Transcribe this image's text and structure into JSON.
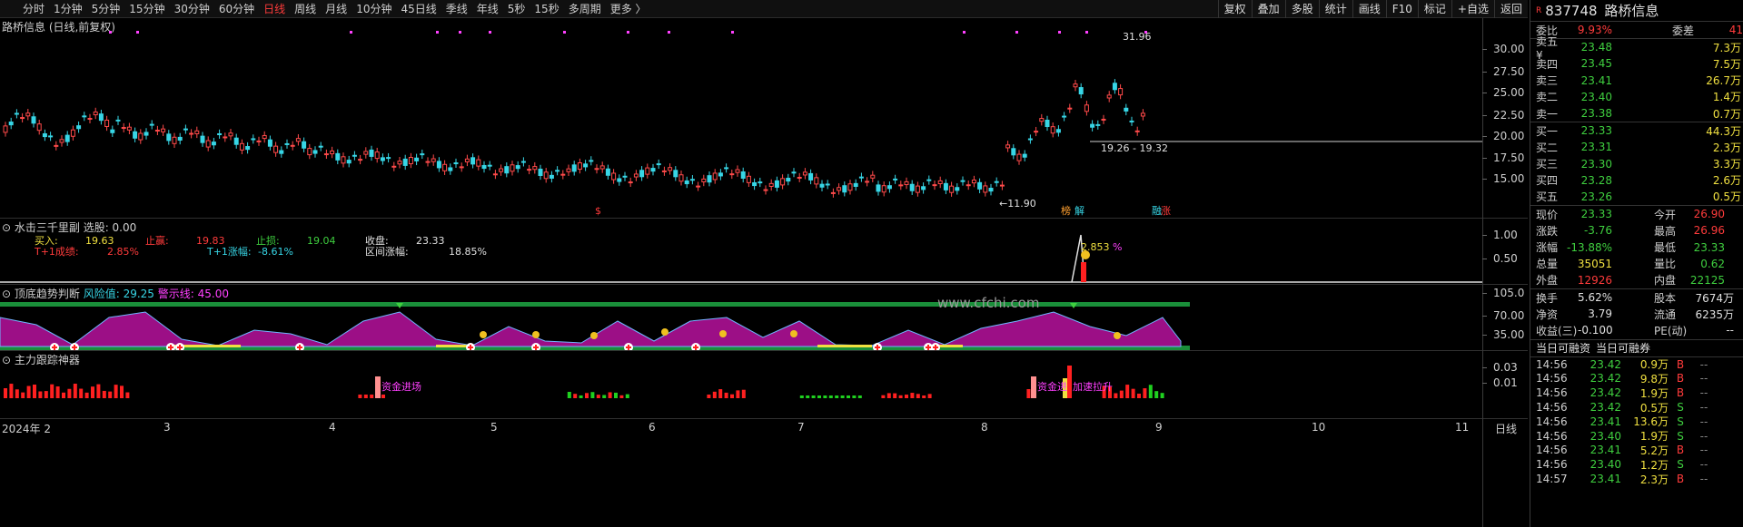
{
  "toolbar": {
    "periods": [
      "分时",
      "1分钟",
      "5分钟",
      "15分钟",
      "30分钟",
      "60分钟",
      "日线",
      "周线",
      "月线",
      "10分钟",
      "45日线",
      "季线",
      "年线",
      "5秒",
      "15秒",
      "多周期",
      "更多 〉"
    ],
    "active_period": "日线",
    "tools": [
      "复权",
      "叠加",
      "多股",
      "统计",
      "画线",
      "F10",
      "标记",
      "+自选",
      "返回"
    ]
  },
  "main_panel": {
    "title": "路桥信息 (日线,前复权)",
    "annotations": {
      "high": "31.96",
      "low": "←11.90",
      "range": "19.26 - 19.32"
    },
    "signals": [
      "$",
      "榜",
      "解",
      "融",
      "涨"
    ],
    "price_axis": [
      "30.00",
      "27.50",
      "25.00",
      "22.50",
      "20.00",
      "17.50",
      "15.00"
    ]
  },
  "panel2": {
    "title": "水击三千里副  选股: 0.00",
    "labels": [
      {
        "k": "买入:",
        "v": "19.63",
        "kc": "#f0e040",
        "vc": "#f0e040"
      },
      {
        "k": "止赢:",
        "v": "19.83",
        "kc": "#ff3b3b",
        "vc": "#ff3b3b"
      },
      {
        "k": "止损:",
        "v": "19.04",
        "kc": "#3fcf3f",
        "vc": "#3fcf3f"
      },
      {
        "k": "收盘:",
        "v": "23.33",
        "kc": "#e0e0e0",
        "vc": "#e0e0e0"
      },
      {
        "k": "T+1成绩:",
        "v": "2.85%",
        "kc": "#ff3b3b",
        "vc": "#ff3b3b"
      },
      {
        "k": "T+1涨幅:",
        "v": "-8.61%",
        "kc": "#37d6e6",
        "vc": "#37d6e6"
      },
      {
        "k": "区间涨幅:",
        "v": "18.85%",
        "kc": "#e0e0e0",
        "vc": "#e0e0e0"
      }
    ],
    "peak_label": "2.853",
    "peak_unit": "%",
    "axis": [
      "1.00",
      "0.50"
    ]
  },
  "panel3": {
    "title": "顶底趋势判断",
    "risk_label": "风险值: 29.25",
    "warn_label": "警示线: 45.00",
    "axis": [
      "105.0",
      "70.00",
      "35.00"
    ],
    "watermark": "www.cfchi.com"
  },
  "panel4": {
    "title": "主力跟踪神器",
    "axis": [
      "0.03",
      "0.01"
    ],
    "tags": [
      "资金进场",
      "资金进",
      "加速拉升"
    ]
  },
  "date_axis": [
    "2024年 2",
    "3",
    "4",
    "5",
    "6",
    "7",
    "8",
    "9",
    "10",
    "11"
  ],
  "date_axis_mode": "日线",
  "quote": {
    "code": "837748",
    "name": "路桥信息",
    "ratio": {
      "k1": "委比",
      "v1": "9.93%",
      "k2": "委差",
      "v2": "41"
    },
    "asks": [
      {
        "label": "卖五 ¥",
        "price": "23.48",
        "vol": "7.3万"
      },
      {
        "label": "卖四",
        "price": "23.45",
        "vol": "7.5万"
      },
      {
        "label": "卖三",
        "price": "23.41",
        "vol": "26.7万"
      },
      {
        "label": "卖二",
        "price": "23.40",
        "vol": "1.4万"
      },
      {
        "label": "卖一",
        "price": "23.38",
        "vol": "0.7万"
      }
    ],
    "bids": [
      {
        "label": "买一",
        "price": "23.33",
        "vol": "44.3万"
      },
      {
        "label": "买二",
        "price": "23.31",
        "vol": "2.3万"
      },
      {
        "label": "买三",
        "price": "23.30",
        "vol": "3.3万"
      },
      {
        "label": "买四",
        "price": "23.28",
        "vol": "2.6万"
      },
      {
        "label": "买五",
        "price": "23.26",
        "vol": "0.5万"
      }
    ],
    "stats": [
      {
        "k1": "现价",
        "v1": "23.33",
        "c1": "green",
        "k2": "今开",
        "v2": "26.90",
        "c2": "red"
      },
      {
        "k1": "涨跌",
        "v1": "-3.76",
        "c1": "green",
        "k2": "最高",
        "v2": "26.96",
        "c2": "red"
      },
      {
        "k1": "涨幅",
        "v1": "-13.88%",
        "c1": "green",
        "k2": "最低",
        "v2": "23.33",
        "c2": "green"
      },
      {
        "k1": "总量",
        "v1": "35051",
        "c1": "yel",
        "k2": "量比",
        "v2": "0.62",
        "c2": "green"
      },
      {
        "k1": "外盘",
        "v1": "12926",
        "c1": "red",
        "k2": "内盘",
        "v2": "22125",
        "c2": "green"
      }
    ],
    "stats2": [
      {
        "k1": "换手",
        "v1": "5.62%",
        "k2": "股本",
        "v2": "7674万"
      },
      {
        "k1": "净资",
        "v1": "3.79",
        "k2": "流通",
        "v2": "6235万"
      },
      {
        "k1": "收益(三)",
        "v1": "-0.100",
        "k2": "PE(动)",
        "v2": "--"
      }
    ],
    "margin": {
      "a": "当日可融资",
      "b": "当日可融券"
    },
    "ticks": [
      {
        "t": "14:56",
        "p": "23.42",
        "v": "0.9万",
        "s": "B"
      },
      {
        "t": "14:56",
        "p": "23.42",
        "v": "9.8万",
        "s": "B"
      },
      {
        "t": "14:56",
        "p": "23.42",
        "v": "1.9万",
        "s": "B"
      },
      {
        "t": "14:56",
        "p": "23.42",
        "v": "0.5万",
        "s": "S"
      },
      {
        "t": "14:56",
        "p": "23.41",
        "v": "13.6万",
        "s": "S"
      },
      {
        "t": "14:56",
        "p": "23.40",
        "v": "1.9万",
        "s": "S"
      },
      {
        "t": "14:56",
        "p": "23.41",
        "v": "5.2万",
        "s": "B"
      },
      {
        "t": "14:56",
        "p": "23.40",
        "v": "1.2万",
        "s": "S"
      },
      {
        "t": "14:57",
        "p": "23.41",
        "v": "2.3万",
        "s": "B"
      }
    ],
    "tick_dash": "--"
  }
}
